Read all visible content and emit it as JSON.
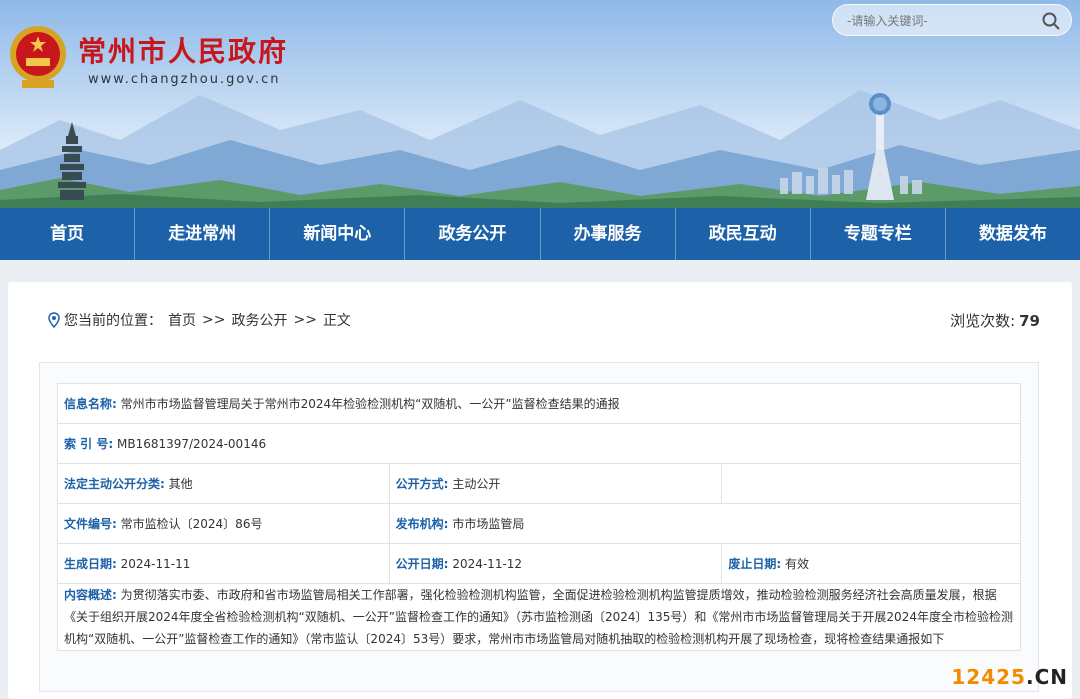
{
  "site": {
    "title": "常州市人民政府",
    "url": "www.changzhou.gov.cn"
  },
  "search": {
    "placeholder": "-请输入关键词-"
  },
  "nav": {
    "items": [
      "首页",
      "走进常州",
      "新闻中心",
      "政务公开",
      "办事服务",
      "政民互动",
      "专题专栏",
      "数据发布"
    ]
  },
  "breadcrumb": {
    "prefix": "您当前的位置：",
    "items": [
      "首页",
      "政务公开",
      "正文"
    ],
    "separator": ">>"
  },
  "views": {
    "label": "浏览次数:",
    "count": "79"
  },
  "info": {
    "name_label": "信息名称:",
    "name_value": "常州市市场监督管理局关于常州市2024年检验检测机构“双随机、一公开”监督检查结果的通报",
    "index_label": "索 引 号:",
    "index_value": "MB1681397/2024-00146",
    "category_label": "法定主动公开分类:",
    "category_value": "其他",
    "method_label": "公开方式:",
    "method_value": "主动公开",
    "docno_label": "文件编号:",
    "docno_value": "常市监检认〔2024〕86号",
    "issuer_label": "发布机构:",
    "issuer_value": "市市场监管局",
    "created_label": "生成日期:",
    "created_value": "2024-11-11",
    "published_label": "公开日期:",
    "published_value": "2024-11-12",
    "expire_label": "废止日期:",
    "expire_value": "有效",
    "summary_label": "内容概述:",
    "summary_value": "为贯彻落实市委、市政府和省市场监管局相关工作部署，强化检验检测机构监管，全面促进检验检测机构监管提质增效，推动检验检测服务经济社会高质量发展，根据《关于组织开展2024年度全省检验检测机构“双随机、一公开”监督检查工作的通知》（苏市监检测函〔2024〕135号）和《常州市市场监督管理局关于开展2024年度全市检验检测机构“双随机、一公开”监督检查工作的通知》（常市监认〔2024〕53号）要求，常州市市场监管局对随机抽取的检验检测机构开展了现场检查，现将检查结果通报如下"
  },
  "watermark": {
    "num": "12425",
    "dot": ".",
    "cn": "CN"
  },
  "colors": {
    "nav": "#1d62a8",
    "title": "#c8161d",
    "label": "#1d62a8"
  }
}
